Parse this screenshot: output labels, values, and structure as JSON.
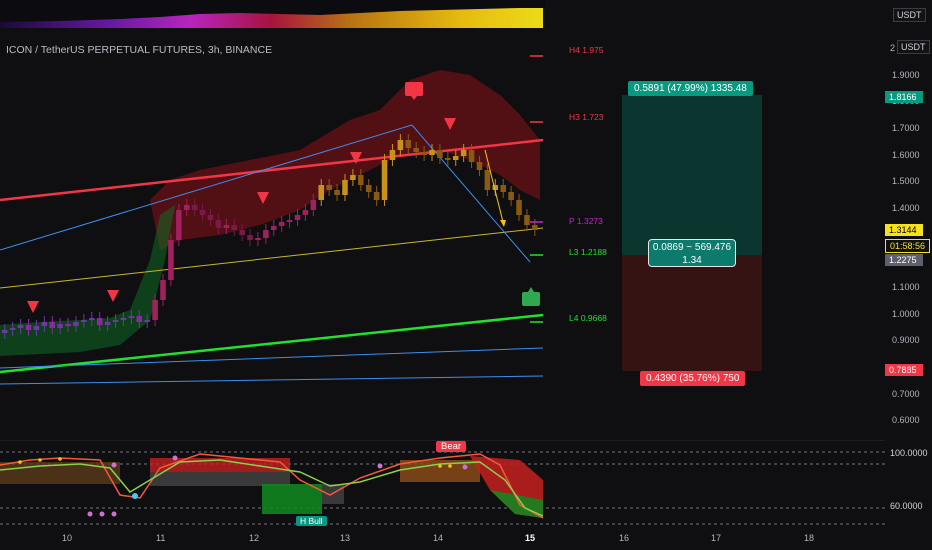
{
  "header": {
    "symbol_title": "ICON / TetherUS PERPETUAL FUTURES, 3h, BINANCE",
    "top_currency": "USDT"
  },
  "price_axis": {
    "currency": "USDT",
    "ticks": [
      "2",
      "1.9000",
      "1.8000",
      "1.7000",
      "1.6000",
      "1.5000",
      "1.4000",
      "1.1000",
      "1.0000",
      "0.9000",
      "0.7000",
      "0.6000"
    ]
  },
  "price_tags": {
    "upper": "1.8166",
    "current": "1.3144",
    "countdown": "01:58:56",
    "lower_gray": "1.2275",
    "stop": "0.7885"
  },
  "pivots": {
    "h4": "H4 1.975",
    "h3": "H3 1.723",
    "p": "P 1.3273",
    "l3": "L3 1.2188",
    "l4": "L4 0.9668"
  },
  "position": {
    "target_label": "0.5891 (47.99%) 1335.48",
    "center_line1": "0.0869 ~ 569.476",
    "center_line2": "1.34",
    "stop_label": "0.4390 (35.76%) 750",
    "colors": {
      "target": "#089981",
      "stop": "#f23645"
    }
  },
  "time_axis": {
    "labels": [
      "10",
      "11",
      "12",
      "13",
      "14",
      "15",
      "16",
      "17",
      "18"
    ]
  },
  "indicator": {
    "ticks": [
      "100.0000",
      "60.0000"
    ],
    "bear_label": "Bear",
    "hbull_label": "H Bull"
  },
  "markers": {
    "sl_icon": "SL",
    "flag_icon": "flag-icon"
  }
}
